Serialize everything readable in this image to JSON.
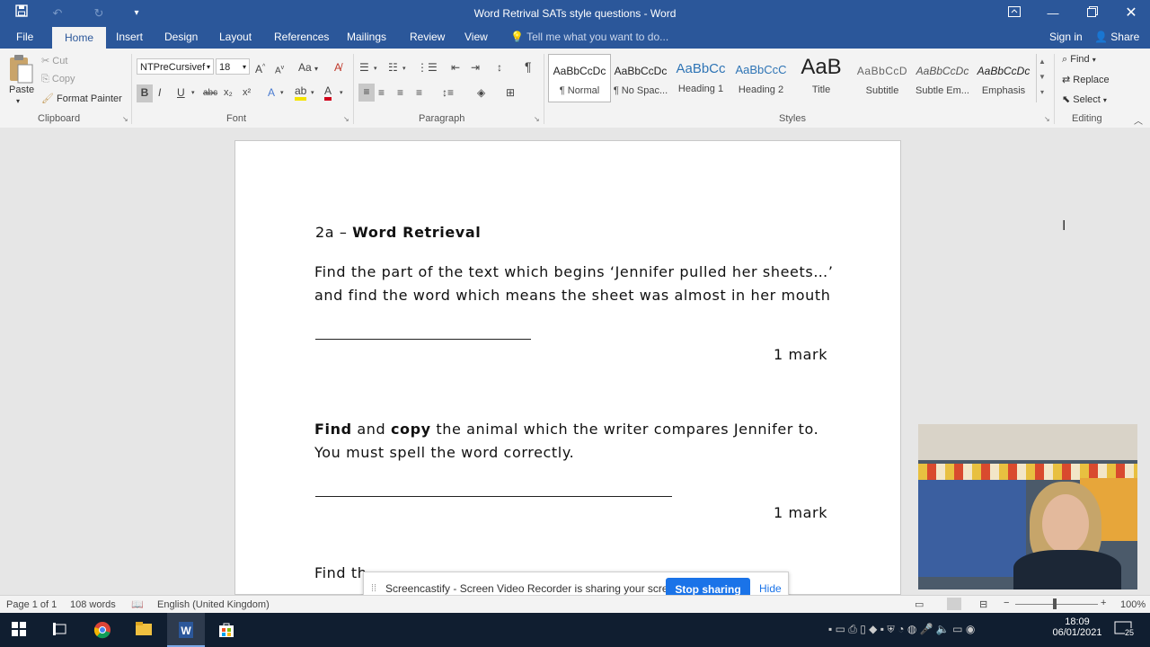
{
  "window": {
    "title": "Word Retrival SATs style questions - Word"
  },
  "tabs": [
    "File",
    "Home",
    "Insert",
    "Design",
    "Layout",
    "References",
    "Mailings",
    "Review",
    "View"
  ],
  "tell_me": "Tell me what you want to do...",
  "account": {
    "sign_in": "Sign in",
    "share": "Share"
  },
  "clipboard": {
    "paste": "Paste",
    "cut": "Cut",
    "copy": "Copy",
    "format_painter": "Format Painter",
    "label": "Clipboard"
  },
  "font": {
    "name": "NTPreCursivef",
    "size": "18",
    "label": "Font",
    "bold": "B",
    "italic": "I",
    "underline": "U",
    "strike": "abc",
    "sub": "x₂",
    "sup": "x²",
    "grow": "A",
    "shrink": "A",
    "case": "Aa"
  },
  "paragraph": {
    "label": "Paragraph"
  },
  "styles": {
    "label": "Styles",
    "items": [
      {
        "preview": "AaBbCcDc",
        "name": "¶ Normal"
      },
      {
        "preview": "AaBbCcDc",
        "name": "¶ No Spac..."
      },
      {
        "preview": "AaBbCc",
        "name": "Heading 1"
      },
      {
        "preview": "AaBbCcC",
        "name": "Heading 2"
      },
      {
        "preview": "AaB",
        "name": "Title"
      },
      {
        "preview": "AaBbCcD",
        "name": "Subtitle"
      },
      {
        "preview": "AaBbCcDc",
        "name": "Subtle Em..."
      },
      {
        "preview": "AaBbCcDc",
        "name": "Emphasis"
      }
    ]
  },
  "editing": {
    "find": "Find",
    "replace": "Replace",
    "select": "Select",
    "label": "Editing"
  },
  "document": {
    "heading_prefix": "2a",
    "heading_dash": "–",
    "heading_main": "Word Retrieval",
    "q1_line1": "Find the part of the text which begins ‘Jennifer pulled her sheets…’",
    "q1_line2": "and find the word which means the sheet was almost in her mouth",
    "mark1": "1 mark",
    "q2_find": "Find",
    "q2_and": "and",
    "q2_copy": "copy",
    "q2_rest": "the animal which the writer compares Jennifer to.",
    "q2_line2": "You must spell the word correctly.",
    "mark2": "1 mark",
    "q3_start": "Find th"
  },
  "status": {
    "page": "Page 1 of 1",
    "words": "108 words",
    "language": "English (United Kingdom)",
    "zoom": "100%"
  },
  "banner": {
    "text": "Screencastify - Screen Video Recorder is sharing your screen.",
    "stop": "Stop sharing",
    "hide": "Hide"
  },
  "taskbar": {
    "time": "18:09",
    "date": "06/01/2021",
    "notifications": "25"
  },
  "colors": {
    "word_blue": "#2b579a",
    "banner_button": "#1a73e8",
    "taskbar": "#101e30"
  }
}
